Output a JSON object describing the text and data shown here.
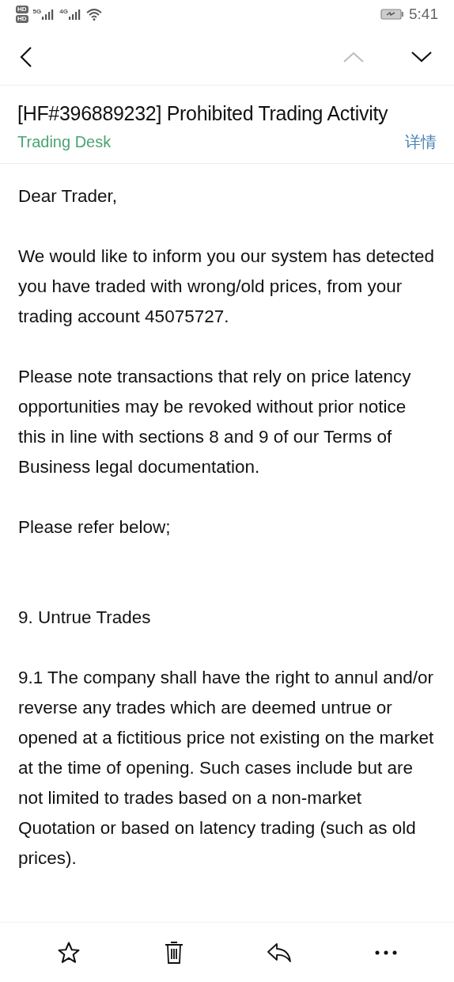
{
  "status_bar": {
    "sim_badges": [
      "HD",
      "HD"
    ],
    "networks": [
      "5G",
      "4G"
    ],
    "time": "5:41"
  },
  "email": {
    "subject": "[HF#396889232] Prohibited Trading Activity",
    "sender": "Trading Desk",
    "details_link": "详情",
    "body": [
      {
        "kind": "paragraph",
        "text": "Dear Trader,"
      },
      {
        "kind": "paragraph",
        "text": "We would like to inform you our system has detected you have traded with wrong/old prices, from your trading account 45075727."
      },
      {
        "kind": "paragraph",
        "text": "Please note transactions that rely on price latency opportunities may be revoked without prior notice this in line with sections 8 and 9 of our Terms of Business legal documentation."
      },
      {
        "kind": "paragraph",
        "text": "Please refer below;"
      },
      {
        "kind": "heading",
        "text": "9. Untrue Trades"
      },
      {
        "kind": "paragraph",
        "text": "9.1 The company shall have the right to annul and/or reverse any trades which are deemed untrue or opened at a fictitious price not existing on the market at the time of opening. Such cases include but are not limited to trades based on a non-market Quotation or based on latency trading (such as old prices)."
      }
    ]
  }
}
